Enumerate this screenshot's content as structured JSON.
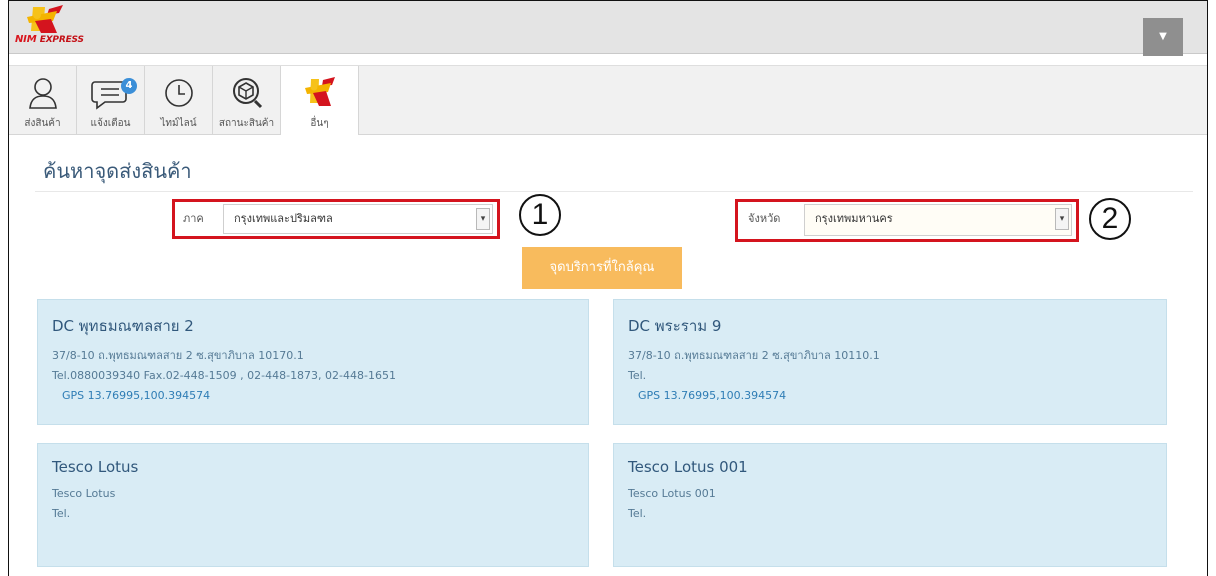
{
  "app": {
    "logo_text": "NIM",
    "logo_subtext": "EXPRESS",
    "menu_icon": "caret-down-icon"
  },
  "tabs": [
    {
      "label": "ส่งสินค้า",
      "icon": "user-icon"
    },
    {
      "label": "แจ้งเตือน",
      "icon": "chat-bubble-icon",
      "badge": "4"
    },
    {
      "label": "ไทม์ไลน์",
      "icon": "clock-icon"
    },
    {
      "label": "สถานะสินค้า",
      "icon": "package-search-icon"
    },
    {
      "label": "อื่นๆ",
      "icon": "nim-logo-icon"
    }
  ],
  "active_tab": "อื่นๆ",
  "page": {
    "title": "ค้นหาจุดส่งสินค้า"
  },
  "filters": {
    "region_label": "ภาค",
    "region_value": "กรุงเทพและปริมลฑล",
    "province_label": "จังหวัด",
    "province_value": "กรุงเทพมหานคร",
    "callout_1": "1",
    "callout_2": "2"
  },
  "find_button": "จุดบริการที่ใกล้คุณ",
  "locations": [
    {
      "name": "DC พุทธมณฑลสาย 2",
      "address": "37/8-10 ถ.พุทธมณฑลสาย 2 ซ.สุขาภิบาล 10170.1",
      "tel": "Tel.0880039340 Fax.02-448-1509 , 02-448-1873, 02-448-1651",
      "gps": "GPS 13.76995,100.394574"
    },
    {
      "name": "DC พระราม 9",
      "address": "37/8-10 ถ.พุทธมณฑลสาย 2 ซ.สุขาภิบาล 10110.1",
      "tel": "Tel.",
      "gps": "GPS 13.76995,100.394574"
    },
    {
      "name": "Tesco Lotus",
      "address": "Tesco Lotus",
      "tel": "Tel."
    },
    {
      "name": "Tesco Lotus 001",
      "address": "Tesco Lotus 001",
      "tel": "Tel."
    }
  ],
  "colors": {
    "brand_red": "#d4141e",
    "brand_yellow": "#f6c21a",
    "button_orange": "#f8bb5d",
    "card_blue": "#d9ecf5",
    "title_blue": "#3a5a79"
  }
}
